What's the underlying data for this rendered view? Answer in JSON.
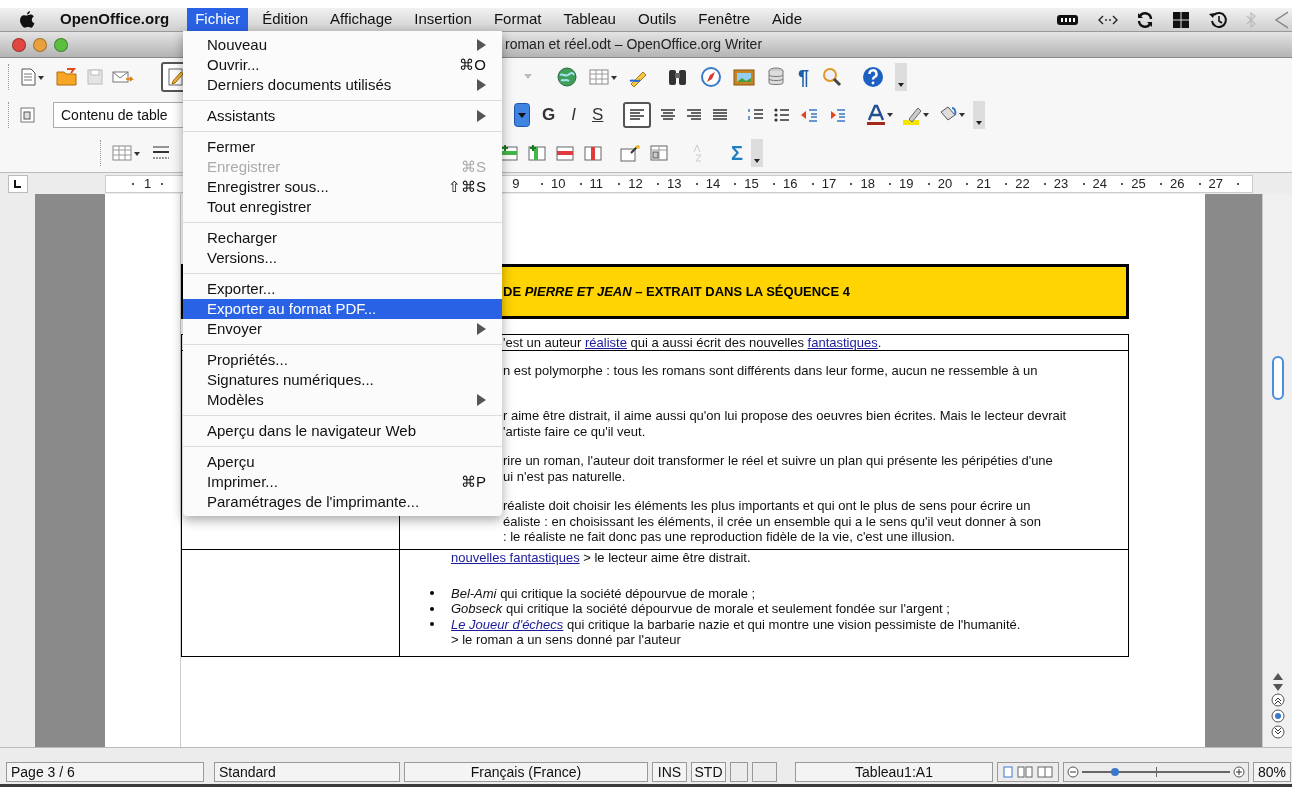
{
  "menubar": {
    "app": "OpenOffice.org",
    "items": [
      {
        "label": "Fichier",
        "selected": true
      },
      {
        "label": "Édition",
        "selected": false
      },
      {
        "label": "Affichage",
        "selected": false
      },
      {
        "label": "Insertion",
        "selected": false
      },
      {
        "label": "Format",
        "selected": false
      },
      {
        "label": "Tableau",
        "selected": false
      },
      {
        "label": "Outils",
        "selected": false
      },
      {
        "label": "Fenêtre",
        "selected": false
      },
      {
        "label": "Aide",
        "selected": false
      }
    ]
  },
  "window": {
    "title": "roman et réel.odt – OpenOffice.org Writer"
  },
  "toolbar_1": {
    "edit_mode_on": true,
    "glyphs": [
      "¶"
    ]
  },
  "toolbar_2": {
    "style_field": {
      "value": "Contenu de table"
    },
    "format_glyphs": [
      "G",
      "I",
      "S"
    ],
    "align_left_on": true
  },
  "toolbar_3": {
    "glyphs": [
      "Σ"
    ]
  },
  "ruler": {
    "left_numbers": [
      "1"
    ],
    "numbers": [
      "9",
      "10",
      "11",
      "12",
      "13",
      "14",
      "15",
      "16",
      "17",
      "18",
      "19",
      "20",
      "21",
      "22",
      "23",
      "24",
      "25",
      "26",
      "27"
    ]
  },
  "document": {
    "heading": "DE *PIERRE ET JEAN* – EXTRAIT DANS LA SÉQUENCE 4",
    "row_1": [
      {
        "kind": "text",
        "text": "'est un auteur "
      },
      {
        "kind": "link",
        "text": "réaliste"
      },
      {
        "kind": "text",
        "text": " qui a aussi écrit des nouvelles "
      },
      {
        "kind": "link",
        "text": "fantastiques"
      },
      {
        "kind": "text",
        "text": "."
      }
    ],
    "row_2": [
      [
        "n est polymorphe : tous les romans sont différents dans leur forme, aucun ne ressemble à un"
      ],
      [
        "r aime être distrait, il aime aussi qu'on lui propose des oeuvres bien écrites. Mais le lecteur devrait",
        "'artiste faire ce qu'il veut."
      ],
      [
        "rire un roman, l'auteur doit transformer le réel et suivre un plan qui présente les péripéties d'une",
        "ui n'est pas naturelle."
      ],
      [
        "réaliste doit choisir les éléments les plus importants et qui ont le plus de sens pour écrire un",
        "éaliste : en choisissant les éléments, il crée un ensemble qui a le sens qu'il veut donner à son",
        ": le réaliste ne fait donc pas une reproduction fidèle de la vie, c'est une illusion."
      ]
    ],
    "row_3": {
      "intro": [
        {
          "kind": "link",
          "text": "nouvelles fantastiques"
        },
        {
          "kind": "text",
          "text": " > le lecteur aime être distrait."
        }
      ],
      "bullets": [
        [
          {
            "kind": "italic",
            "text": "Bel-Ami"
          },
          {
            "kind": "text",
            "text": " qui critique la société dépourvue de morale ;"
          }
        ],
        [
          {
            "kind": "italic",
            "text": "Gobseck"
          },
          {
            "kind": "text",
            "text": " qui critique la société dépourvue de morale et seulement fondée sur l'argent ;"
          }
        ],
        [
          {
            "kind": "link_italic",
            "text": "Le Joueur d'échecs"
          },
          {
            "kind": "text",
            "text": " qui critique la barbarie nazie et qui montre une vision pessimiste de l'humanité."
          }
        ]
      ],
      "note": "> le roman a un sens donné par l'auteur"
    }
  },
  "file_menu": [
    {
      "kind": "item",
      "label": "Nouveau",
      "submenu": true,
      "disabled": false,
      "selected": false
    },
    {
      "kind": "item",
      "label": "Ouvrir...",
      "shortcut": "⌘O",
      "submenu": false,
      "disabled": false,
      "selected": false
    },
    {
      "kind": "item",
      "label": "Derniers documents utilisés",
      "submenu": true,
      "disabled": false,
      "selected": false
    },
    {
      "kind": "separator"
    },
    {
      "kind": "item",
      "label": "Assistants",
      "submenu": true,
      "disabled": false,
      "selected": false
    },
    {
      "kind": "separator"
    },
    {
      "kind": "item",
      "label": "Fermer",
      "submenu": false,
      "disabled": false,
      "selected": false
    },
    {
      "kind": "item",
      "label": "Enregistrer",
      "shortcut": "⌘S",
      "submenu": false,
      "disabled": true,
      "selected": false
    },
    {
      "kind": "item",
      "label": "Enregistrer sous...",
      "shortcut": "⇧⌘S",
      "submenu": false,
      "disabled": false,
      "selected": false
    },
    {
      "kind": "item",
      "label": "Tout enregistrer",
      "submenu": false,
      "disabled": false,
      "selected": false
    },
    {
      "kind": "separator"
    },
    {
      "kind": "item",
      "label": "Recharger",
      "submenu": false,
      "disabled": false,
      "selected": false
    },
    {
      "kind": "item",
      "label": "Versions...",
      "submenu": false,
      "disabled": false,
      "selected": false
    },
    {
      "kind": "separator"
    },
    {
      "kind": "item",
      "label": "Exporter...",
      "submenu": false,
      "disabled": false,
      "selected": false
    },
    {
      "kind": "item",
      "label": "Exporter au format PDF...",
      "submenu": false,
      "disabled": false,
      "selected": true
    },
    {
      "kind": "item",
      "label": "Envoyer",
      "submenu": true,
      "disabled": false,
      "selected": false
    },
    {
      "kind": "separator"
    },
    {
      "kind": "item",
      "label": "Propriétés...",
      "submenu": false,
      "disabled": false,
      "selected": false
    },
    {
      "kind": "item",
      "label": "Signatures numériques...",
      "submenu": false,
      "disabled": false,
      "selected": false
    },
    {
      "kind": "item",
      "label": "Modèles",
      "submenu": true,
      "disabled": false,
      "selected": false
    },
    {
      "kind": "separator"
    },
    {
      "kind": "item",
      "label": "Aperçu dans le navigateur Web",
      "submenu": false,
      "disabled": false,
      "selected": false
    },
    {
      "kind": "separator"
    },
    {
      "kind": "item",
      "label": "Aperçu",
      "submenu": false,
      "disabled": false,
      "selected": false
    },
    {
      "kind": "item",
      "label": "Imprimer...",
      "shortcut": "⌘P",
      "submenu": false,
      "disabled": false,
      "selected": false
    },
    {
      "kind": "item",
      "label": "Paramétrages de l'imprimante...",
      "submenu": false,
      "disabled": false,
      "selected": false
    }
  ],
  "status_bar": {
    "page": "Page 3 / 6",
    "style": "Standard",
    "language": "Français (France)",
    "insert_mode": "INS",
    "selection_mode": "STD",
    "cell": "Tableau1:A1",
    "zoom": {
      "level": 0.22
    },
    "zoom_percent": "80%"
  }
}
